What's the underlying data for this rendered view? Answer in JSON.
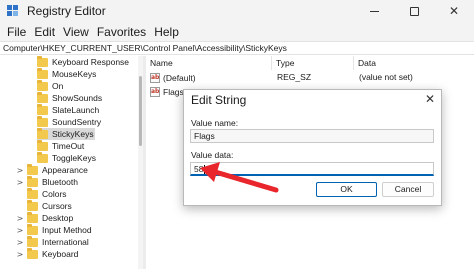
{
  "window": {
    "title": "Registry Editor",
    "controls": {
      "minimize": "—",
      "maximize": "",
      "close": "✕"
    }
  },
  "menu": [
    "File",
    "Edit",
    "View",
    "Favorites",
    "Help"
  ],
  "address": "Computer\\HKEY_CURRENT_USER\\Control Panel\\Accessibility\\StickyKeys",
  "tree": {
    "items": [
      {
        "label": "Keyboard Response",
        "expander": "",
        "indent": 1
      },
      {
        "label": "MouseKeys",
        "expander": "",
        "indent": 1
      },
      {
        "label": "On",
        "expander": "",
        "indent": 1
      },
      {
        "label": "ShowSounds",
        "expander": "",
        "indent": 1
      },
      {
        "label": "SlateLaunch",
        "expander": "",
        "indent": 1
      },
      {
        "label": "SoundSentry",
        "expander": "",
        "indent": 1
      },
      {
        "label": "StickyKeys",
        "expander": "",
        "indent": 1,
        "selected": true
      },
      {
        "label": "TimeOut",
        "expander": "",
        "indent": 1
      },
      {
        "label": "ToggleKeys",
        "expander": "",
        "indent": 1
      },
      {
        "label": "Appearance",
        "expander": ">",
        "indent": 0
      },
      {
        "label": "Bluetooth",
        "expander": ">",
        "indent": 0
      },
      {
        "label": "Colors",
        "expander": "",
        "indent": 0
      },
      {
        "label": "Cursors",
        "expander": "",
        "indent": 0
      },
      {
        "label": "Desktop",
        "expander": ">",
        "indent": 0
      },
      {
        "label": "Input Method",
        "expander": ">",
        "indent": 0
      },
      {
        "label": "International",
        "expander": ">",
        "indent": 0
      },
      {
        "label": "Keyboard",
        "expander": ">",
        "indent": 0
      }
    ]
  },
  "values_pane": {
    "headers": {
      "name": "Name",
      "type": "Type",
      "data": "Data"
    },
    "rows": [
      {
        "name": "(Default)",
        "type": "REG_SZ",
        "data": "(value not set)",
        "icon": "ab"
      },
      {
        "name": "Flags",
        "type": "",
        "data": "",
        "icon": "ab"
      }
    ]
  },
  "dialog": {
    "title": "Edit String",
    "close": "✕",
    "value_name_label": "Value name:",
    "value_name": "Flags",
    "value_data_label": "Value data:",
    "value_data": "58",
    "ok_label": "OK",
    "cancel_label": "Cancel"
  },
  "colors": {
    "accent": "#0063b1",
    "annotation": "#e8262b",
    "folder": "#f2c94c"
  }
}
